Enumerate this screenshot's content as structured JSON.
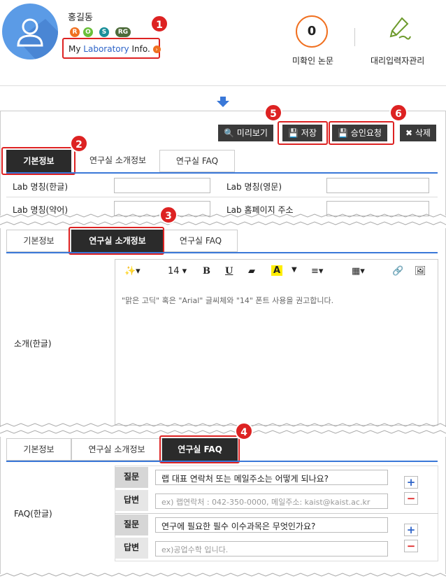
{
  "profile": {
    "name": "홍길동",
    "badges": [
      "R",
      "O",
      "S",
      "RG"
    ],
    "my_lab": {
      "pre": "My ",
      "highlight": "Laboratory",
      "post": " Info."
    }
  },
  "stats": {
    "unread_count": "0",
    "unread_label": "미확인 논문",
    "proxy_label": "대리입력자관리"
  },
  "toolbar": {
    "preview": "미리보기",
    "save": "저장",
    "request": "승인요청",
    "delete": "삭제"
  },
  "tabs": {
    "basic": "기본정보",
    "intro": "연구실 소개정보",
    "faq": "연구실 FAQ"
  },
  "basic_form": {
    "name_ko": "Lab 명칭(한글)",
    "name_en": "Lab 명칭(영문)",
    "name_abbr": "Lab 명칭(약어)",
    "homepage": "Lab 홈페이지 주소"
  },
  "intro": {
    "label": "소개(한글)",
    "font_size": "14",
    "hint": "\"맑은 고딕\" 혹은 \"Arial\" 글씨체와 \"14\" 폰트 사용을 권고합니다."
  },
  "faq": {
    "label": "FAQ(한글)",
    "q_label": "질문",
    "a_label": "답변",
    "items": [
      {
        "question": "랩 대표 연락처 또는 메일주소는 어떻게 되나요?",
        "answer_placeholder": "ex) 랩연락처 : 042-350-0000, 메일주소: kaist@kaist.ac.kr"
      },
      {
        "question": "연구에 필요한 필수 이수과목은 무엇인가요?",
        "answer_placeholder": "ex)공업수학 입니다."
      }
    ]
  },
  "callouts": [
    "1",
    "2",
    "3",
    "4",
    "5",
    "6"
  ]
}
